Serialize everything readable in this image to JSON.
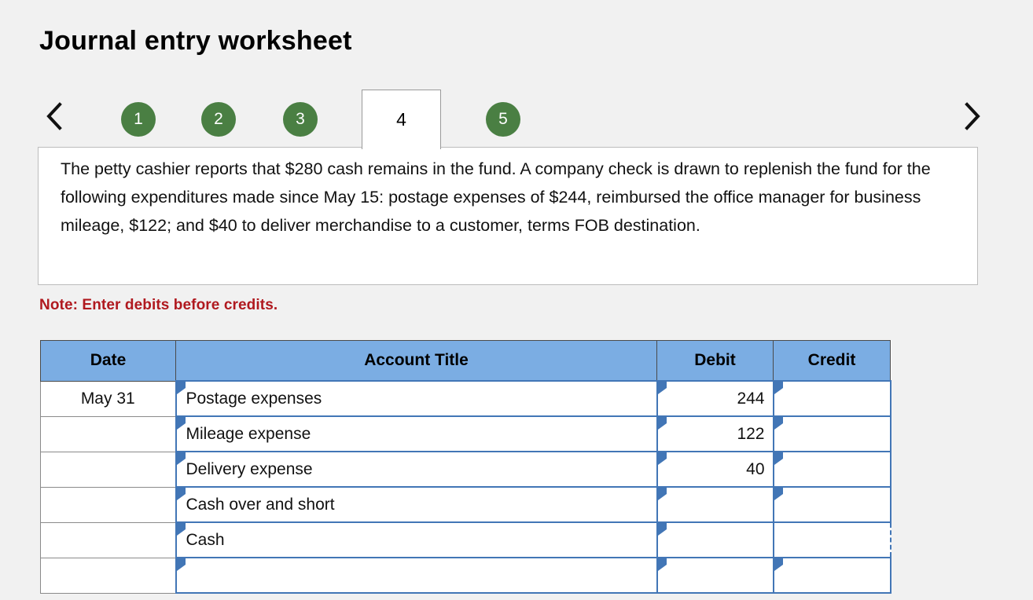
{
  "page": {
    "title": "Journal entry worksheet",
    "background_color": "#f1f1f1"
  },
  "tabs": {
    "prev_label": "‹",
    "next_label": "›",
    "prev_icon": "chevron-left-icon",
    "next_icon": "chevron-right-icon",
    "active_value": "4",
    "accent_color": "#4a7f43",
    "items": [
      {
        "label": "1",
        "active": false
      },
      {
        "label": "2",
        "active": false
      },
      {
        "label": "3",
        "active": false
      },
      {
        "label": "4",
        "active": true
      },
      {
        "label": "5",
        "active": false
      }
    ]
  },
  "question": {
    "text": "The petty cashier reports that $280 cash remains in the fund. A company check is drawn to replenish the fund for the following expenditures made since May 15: postage expenses of $244, reimbursed the office manager for business mileage, $122; and $40 to deliver merchandise to a customer, terms FOB destination."
  },
  "note": {
    "text": "Note: Enter debits before credits.",
    "color": "#b0191f"
  },
  "journal": {
    "header_color": "#7bade3",
    "cell_border_color": "#4276b6",
    "columns": [
      {
        "key": "date",
        "label": "Date"
      },
      {
        "key": "account",
        "label": "Account Title"
      },
      {
        "key": "debit",
        "label": "Debit"
      },
      {
        "key": "credit",
        "label": "Credit"
      }
    ],
    "rows": [
      {
        "date": "May 31",
        "account": "Postage expenses",
        "debit": "244",
        "credit": "",
        "credit_selected": false
      },
      {
        "date": "",
        "account": "Mileage expense",
        "debit": "122",
        "credit": "",
        "credit_selected": false
      },
      {
        "date": "",
        "account": "Delivery expense",
        "debit": "40",
        "credit": "",
        "credit_selected": false
      },
      {
        "date": "",
        "account": "Cash over and short",
        "debit": "",
        "credit": "",
        "credit_selected": false
      },
      {
        "date": "",
        "account": "Cash",
        "debit": "",
        "credit": "",
        "credit_selected": true
      },
      {
        "date": "",
        "account": "",
        "debit": "",
        "credit": "",
        "credit_selected": false
      }
    ]
  }
}
